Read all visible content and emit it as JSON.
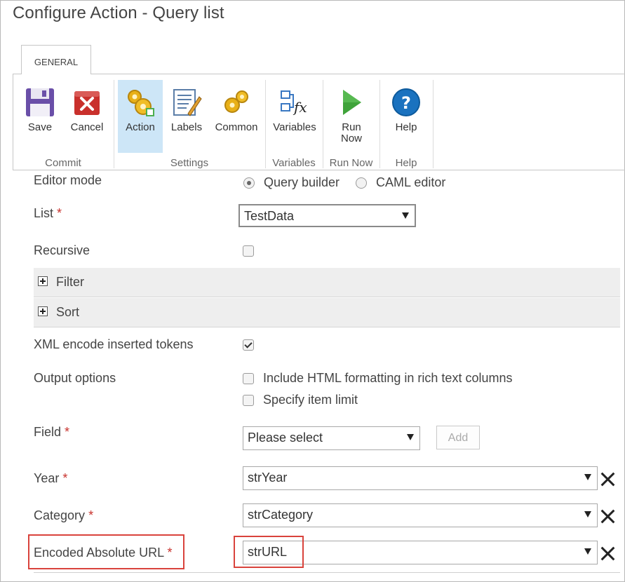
{
  "window": {
    "title": "Configure Action - Query list"
  },
  "tabs": [
    {
      "label": "GENERAL"
    }
  ],
  "ribbon": {
    "groups": [
      {
        "label": "Commit",
        "buttons": [
          {
            "label": "Save",
            "icon": "save-icon"
          },
          {
            "label": "Cancel",
            "icon": "cancel-icon"
          }
        ]
      },
      {
        "label": "Settings",
        "buttons": [
          {
            "label": "Action",
            "icon": "gears-action-icon",
            "selected": true
          },
          {
            "label": "Labels",
            "icon": "labels-icon"
          },
          {
            "label": "Common",
            "icon": "gears-common-icon"
          }
        ]
      },
      {
        "label": "Variables",
        "buttons": [
          {
            "label": "Variables",
            "icon": "variables-fx-icon"
          }
        ]
      },
      {
        "label": "Run Now",
        "buttons": [
          {
            "label": "Run Now",
            "icon": "play-icon"
          }
        ]
      },
      {
        "label": "Help",
        "buttons": [
          {
            "label": "Help",
            "icon": "help-icon"
          }
        ]
      }
    ]
  },
  "form": {
    "editor_mode": {
      "label": "Editor mode",
      "options": [
        "Query builder",
        "CAML editor"
      ],
      "selected": "Query builder"
    },
    "list": {
      "label": "List",
      "required_mark": "*",
      "value": "TestData"
    },
    "recursive": {
      "label": "Recursive",
      "checked": false
    },
    "sections": [
      {
        "label": "Filter"
      },
      {
        "label": "Sort"
      }
    ],
    "xml_encode": {
      "label": "XML encode inserted tokens",
      "checked": true
    },
    "output_options": {
      "label": "Output options",
      "options": [
        {
          "label": "Include HTML formatting in rich text columns",
          "checked": false
        },
        {
          "label": "Specify item limit",
          "checked": false
        }
      ]
    },
    "field": {
      "label": "Field",
      "required_mark": "*",
      "placeholder": "Please select",
      "add_label": "Add"
    },
    "mappings": [
      {
        "label": "Year",
        "required_mark": "*",
        "value": "strYear"
      },
      {
        "label": "Category",
        "required_mark": "*",
        "value": "strCategory"
      },
      {
        "label": "Encoded Absolute URL",
        "required_mark": "*",
        "value": "strURL"
      }
    ]
  },
  "colors": {
    "highlight_red": "#d9433c",
    "selected_blue": "#cde6f7",
    "required_red": "#c8322d"
  }
}
